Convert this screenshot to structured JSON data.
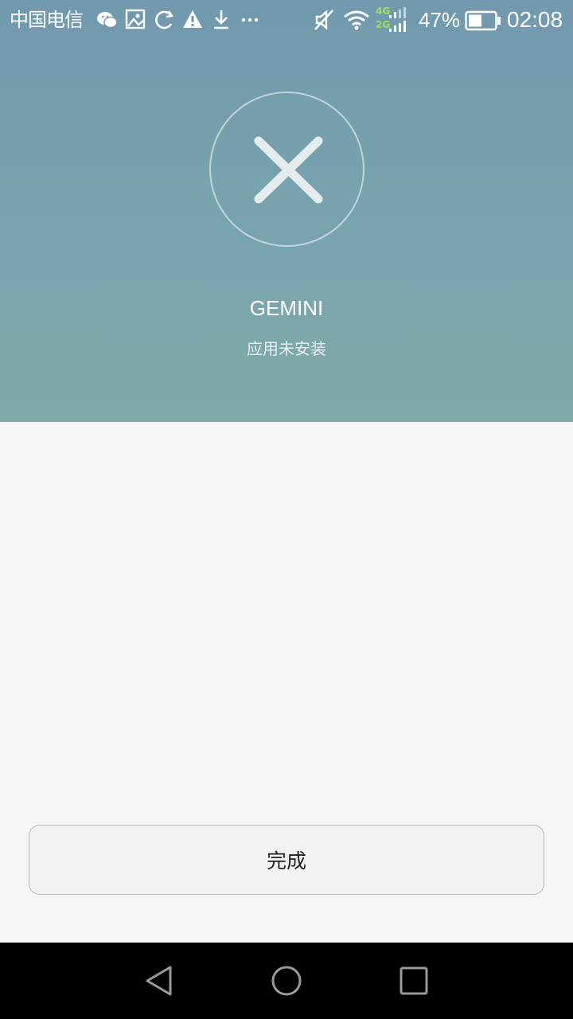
{
  "status_bar": {
    "carrier": "中国电信",
    "network_top": "4G",
    "network_bottom": "2G",
    "battery_percent": "47%",
    "time": "02:08",
    "icons": [
      "wechat-icon",
      "image-icon",
      "sync-icon",
      "warning-icon",
      "download-icon",
      "more-icon",
      "mute-icon",
      "wifi-icon",
      "signal-icon",
      "battery-icon"
    ]
  },
  "result": {
    "icon": "close-icon",
    "app_name": "GEMINI",
    "status": "应用未安装"
  },
  "actions": {
    "done_label": "完成"
  },
  "navigation": {
    "icons": [
      "back-icon",
      "home-icon",
      "recents-icon"
    ]
  },
  "colors": {
    "header_top": "#7299ae",
    "header_bottom": "#80aaa7",
    "background": "#f6f6f6",
    "network_green": "#9be05a"
  }
}
